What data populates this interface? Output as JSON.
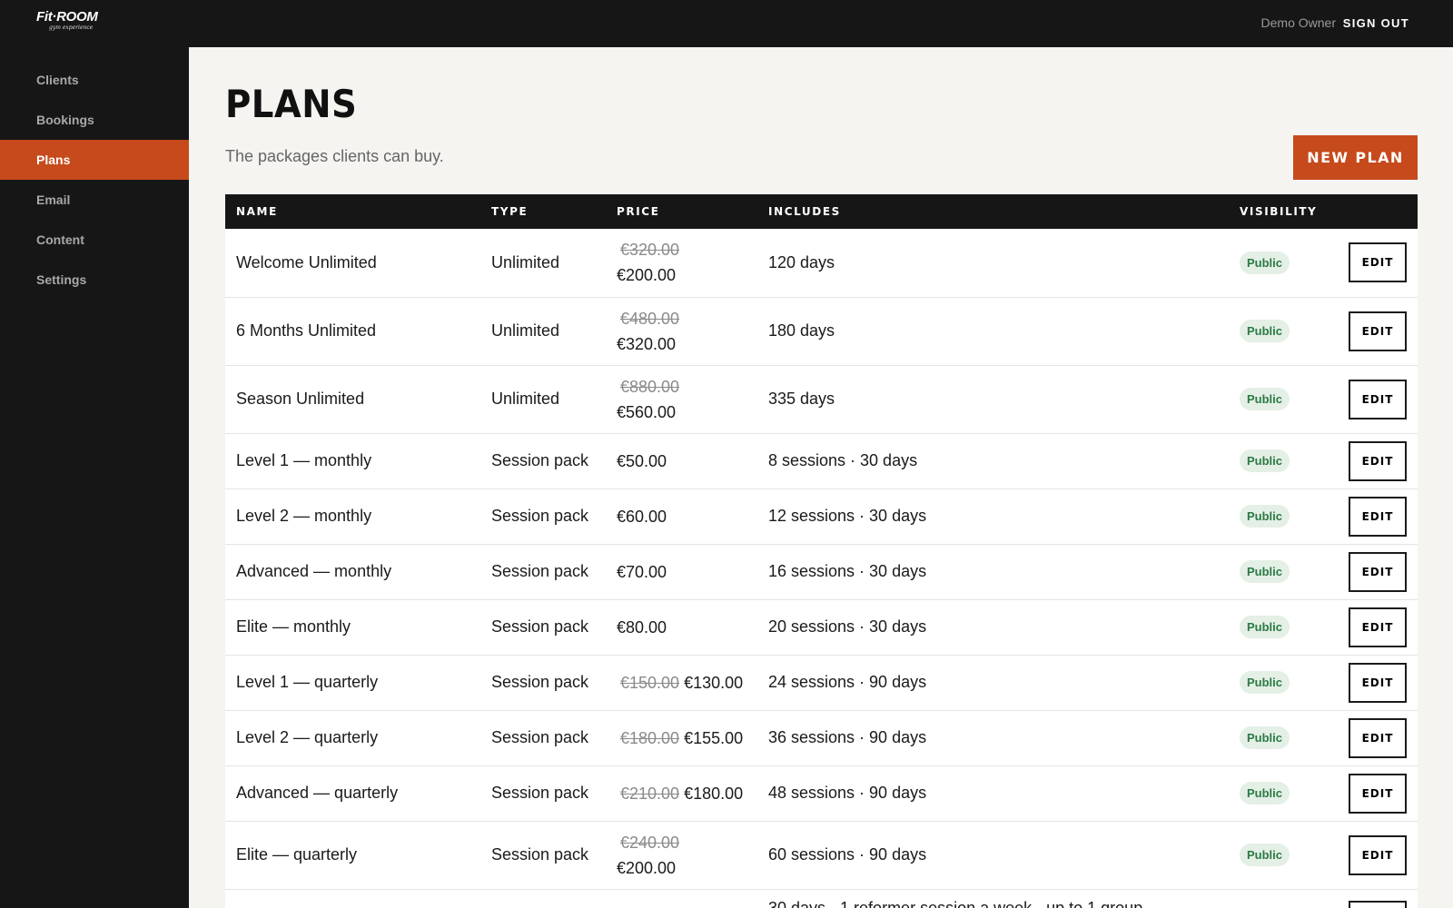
{
  "app": {
    "logo": {
      "main": "Fit·ROOM",
      "sub": "gym experience"
    },
    "user": "Demo Owner",
    "sign_out": "SIGN OUT"
  },
  "sidebar": {
    "items": [
      {
        "label": "Clients",
        "active": false
      },
      {
        "label": "Bookings",
        "active": false
      },
      {
        "label": "Plans",
        "active": true
      },
      {
        "label": "Email",
        "active": false
      },
      {
        "label": "Content",
        "active": false
      },
      {
        "label": "Settings",
        "active": false
      }
    ]
  },
  "page": {
    "title": "PLANS",
    "subtitle": "The packages clients can buy.",
    "new_plan_label": "NEW PLAN"
  },
  "table": {
    "headers": [
      "NAME",
      "TYPE",
      "PRICE",
      "INCLUDES",
      "VISIBILITY"
    ],
    "edit_label": "EDIT",
    "rows": [
      {
        "name": "Welcome Unlimited",
        "type": "Unlimited",
        "old_price": "€320.00",
        "price": "€200.00",
        "includes": "120 days",
        "visibility": "Public"
      },
      {
        "name": "6 Months Unlimited",
        "type": "Unlimited",
        "old_price": "€480.00",
        "price": "€320.00",
        "includes": "180 days",
        "visibility": "Public"
      },
      {
        "name": "Season Unlimited",
        "type": "Unlimited",
        "old_price": "€880.00",
        "price": "€560.00",
        "includes": "335 days",
        "visibility": "Public"
      },
      {
        "name": "Level 1 — monthly",
        "type": "Session pack",
        "old_price": "",
        "price": "€50.00",
        "includes": "8 sessions · 30 days",
        "visibility": "Public"
      },
      {
        "name": "Level 2 — monthly",
        "type": "Session pack",
        "old_price": "",
        "price": "€60.00",
        "includes": "12 sessions · 30 days",
        "visibility": "Public"
      },
      {
        "name": "Advanced — monthly",
        "type": "Session pack",
        "old_price": "",
        "price": "€70.00",
        "includes": "16 sessions · 30 days",
        "visibility": "Public"
      },
      {
        "name": "Elite — monthly",
        "type": "Session pack",
        "old_price": "",
        "price": "€80.00",
        "includes": "20 sessions · 30 days",
        "visibility": "Public"
      },
      {
        "name": "Level 1 — quarterly",
        "type": "Session pack",
        "old_price": "€150.00",
        "price": "€130.00",
        "includes": "24 sessions · 90 days",
        "visibility": "Public"
      },
      {
        "name": "Level 2 — quarterly",
        "type": "Session pack",
        "old_price": "€180.00",
        "price": "€155.00",
        "includes": "36 sessions · 90 days",
        "visibility": "Public"
      },
      {
        "name": "Advanced — quarterly",
        "type": "Session pack",
        "old_price": "€210.00",
        "price": "€180.00",
        "includes": "48 sessions · 90 days",
        "visibility": "Public"
      },
      {
        "name": "Elite — quarterly",
        "type": "Session pack",
        "old_price": "€240.00",
        "price": "€200.00",
        "includes": "60 sessions · 90 days",
        "visibility": "Public"
      }
    ],
    "partial_row": {
      "includes": "30 days · 1 reformer session a week · up to 1 group"
    }
  },
  "colors": {
    "accent": "#c64a1c",
    "dark": "#161616",
    "badge_bg": "#e4efe6",
    "badge_text": "#2b7a44"
  }
}
